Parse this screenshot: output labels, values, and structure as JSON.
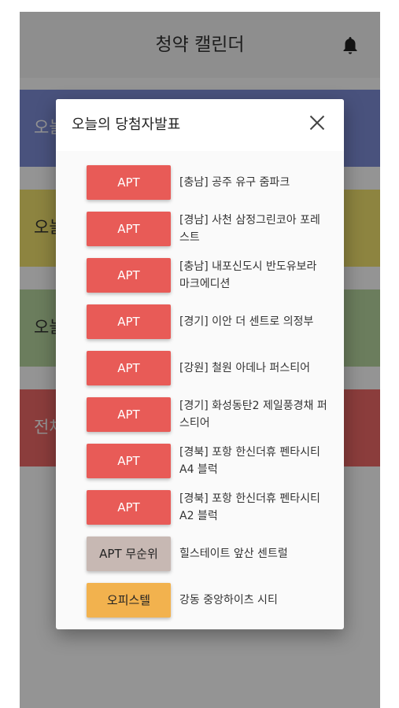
{
  "app": {
    "title": "청약 캘린더"
  },
  "cards": [
    {
      "label": "오늘",
      "color": "#7f8ed8"
    },
    {
      "label": "오늘",
      "color": "#f3e46e"
    },
    {
      "label": "오늘",
      "color": "#b8d8a0"
    },
    {
      "label": "전체",
      "color": "#f06a68"
    }
  ],
  "dialog": {
    "title": "오늘의 당첨자발표",
    "items": [
      {
        "tag": "APT",
        "name": "[충남] 공주 유구 줌파크"
      },
      {
        "tag": "APT",
        "name": "[경남] 사천 삼정그린코아 포레스트"
      },
      {
        "tag": "APT",
        "name": "[충남] 내포신도시 반도유보라 마크에디션"
      },
      {
        "tag": "APT",
        "name": "[경기] 이안 더 센트로 의정부"
      },
      {
        "tag": "APT",
        "name": "[강원] 철원 아데나 퍼스티어"
      },
      {
        "tag": "APT",
        "name": "[경기] 화성동탄2 제일풍경채 퍼스티어"
      },
      {
        "tag": "APT",
        "name": "[경북] 포항 한신더휴 펜타시티 A4 블럭"
      },
      {
        "tag": "APT",
        "name": "[경북] 포항 한신더휴 펜타시티 A2 블럭"
      },
      {
        "tag": "APT 무순위",
        "name": "힐스테이트 앞산 센트럴"
      },
      {
        "tag": "오피스텔",
        "name": "강동 중앙하이츠 시티"
      }
    ]
  },
  "colors": {
    "apt": "#e85b57",
    "apt_unranked": "#c7b8b3",
    "officetel": "#f2b24e"
  }
}
